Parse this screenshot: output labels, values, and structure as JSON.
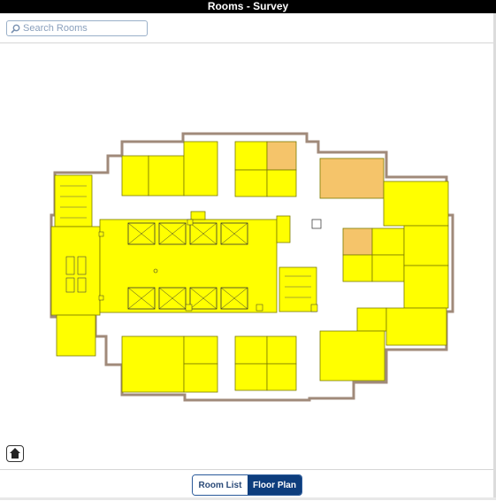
{
  "header": {
    "title": "Rooms - Survey"
  },
  "search": {
    "placeholder": "Search Rooms",
    "value": ""
  },
  "footer": {
    "tabs": [
      {
        "label": "Room List",
        "active": false
      },
      {
        "label": "Floor Plan",
        "active": true
      }
    ]
  },
  "icons": {
    "search": "search-icon",
    "home": "home-icon"
  },
  "colors": {
    "title_bar": "#000000",
    "room_fill": "#ffff00",
    "room_fill_highlight": "#f5c46a",
    "wall": "#a08a7a",
    "active_tab": "#0d3d7d"
  }
}
